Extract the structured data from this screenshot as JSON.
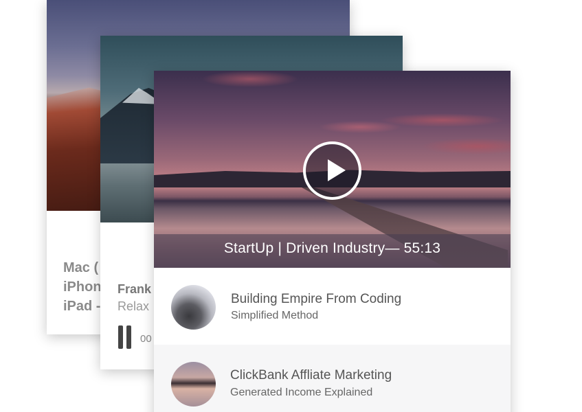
{
  "back_card": {
    "title_lines": [
      "Mac (",
      "iPhon",
      "iPad -"
    ]
  },
  "middle_card": {
    "title": "Frank",
    "subtitle": "Relax",
    "time": "00"
  },
  "front_card": {
    "caption": "StartUp | Driven Industry— 55:13",
    "playlist": [
      {
        "title": "Building Empire From Coding",
        "subtitle": "Simplified Method"
      },
      {
        "title": "ClickBank Affliate Marketing",
        "subtitle": "Generated Income Explained"
      }
    ]
  },
  "icons": [
    "play-icon",
    "pause-icon"
  ],
  "colors": {
    "caption_bar": "#463c50",
    "text_primary": "#555555",
    "text_muted": "#8a8a8a"
  }
}
